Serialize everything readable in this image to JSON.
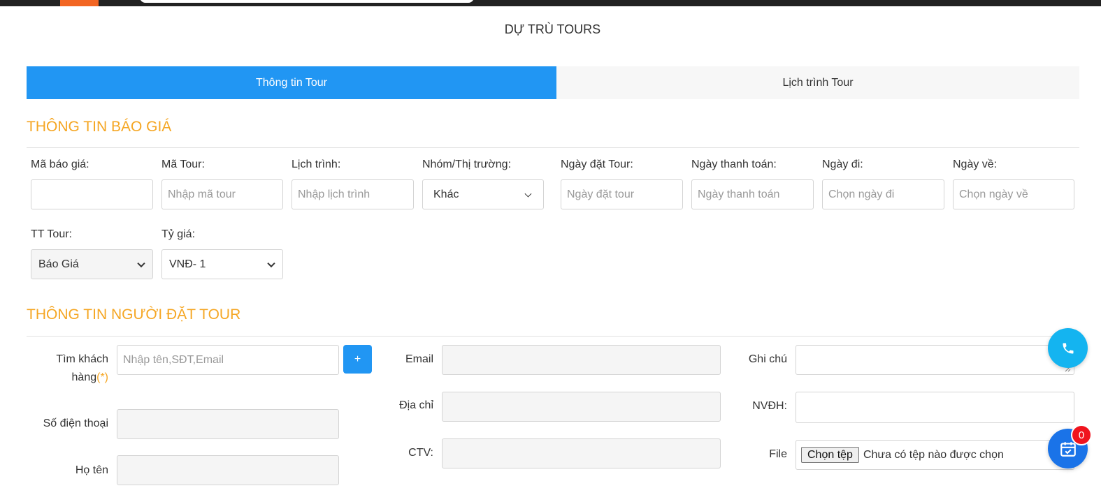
{
  "page_title": "DỰ TRÙ TOURS",
  "tabs": [
    {
      "label": "Thông tin Tour",
      "active": true
    },
    {
      "label": "Lịch trình Tour",
      "active": false
    }
  ],
  "section_quote": {
    "title": "THÔNG TIN BÁO GIÁ",
    "fields": {
      "quote_code": {
        "label": "Mã báo giá:",
        "value": "",
        "placeholder": ""
      },
      "tour_code": {
        "label": "Mã Tour:",
        "value": "",
        "placeholder": "Nhập mã tour"
      },
      "itinerary": {
        "label": "Lịch trình:",
        "value": "",
        "placeholder": "Nhập lịch trình"
      },
      "market_group": {
        "label": "Nhóm/Thị trường:",
        "selected": "Khác"
      },
      "booking_date": {
        "label": "Ngày đặt Tour:",
        "value": "",
        "placeholder": "Ngày đặt tour"
      },
      "payment_date": {
        "label": "Ngày thanh toán:",
        "value": "",
        "placeholder": "Ngày thanh toán"
      },
      "departure_date": {
        "label": "Ngày đi:",
        "value": "",
        "placeholder": "Chọn ngày đi"
      },
      "return_date": {
        "label": "Ngày về:",
        "value": "",
        "placeholder": "Chọn ngày về"
      },
      "tour_status": {
        "label": "TT Tour:",
        "selected": "Báo Giá"
      },
      "exchange_rate": {
        "label": "Tỷ giá:",
        "selected": "VNĐ- 1"
      }
    }
  },
  "section_booker": {
    "title": "THÔNG TIN NGƯỜI ĐẶT TOUR",
    "find_customer": {
      "label": "Tìm khách hàng",
      "required_mark": "(*)",
      "value": "",
      "placeholder": "Nhập tên,SĐT,Email"
    },
    "add_button_label": "+",
    "phone": {
      "label": "Số điện thoại",
      "value": ""
    },
    "full_name": {
      "label": "Họ tên",
      "value": ""
    },
    "email": {
      "label": "Email",
      "value": ""
    },
    "address": {
      "label": "Địa chỉ",
      "value": ""
    },
    "collaborator": {
      "label": "CTV:",
      "value": ""
    },
    "note": {
      "label": "Ghi chú",
      "value": ""
    },
    "operator": {
      "label": "NVĐH:",
      "value": ""
    },
    "file": {
      "label": "File",
      "button_label": "Chọn tệp",
      "status": "Chưa có tệp nào được chọn"
    }
  },
  "floating": {
    "phone_icon": "phone-icon",
    "calendar_icon": "calendar-check-icon",
    "badge_count": "0"
  },
  "colors": {
    "accent": "#2196f3",
    "section_title": "#f5a623",
    "phone_fab": "#14b4f0",
    "calendar_fab": "#1a73e8",
    "badge": "#f0141e"
  }
}
